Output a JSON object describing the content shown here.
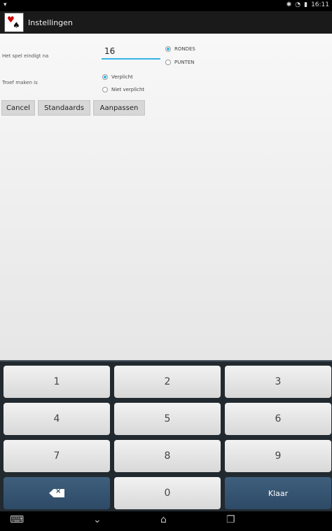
{
  "status_bar": {
    "time": "16:11"
  },
  "app_bar": {
    "title": "Instellingen"
  },
  "form": {
    "game_end_label": "Het spel eindigt na",
    "game_end_value": "16",
    "end_options": [
      "RONDES",
      "PUNTEN"
    ],
    "end_selected": 0,
    "trump_label": "Troef maken is",
    "trump_options": [
      "Verplicht",
      "Niet verplicht"
    ],
    "trump_selected": 0
  },
  "buttons": {
    "cancel": "Cancel",
    "defaults": "Standaards",
    "apply": "Aanpassen"
  },
  "keyboard": {
    "keys": [
      "1",
      "2",
      "3",
      "4",
      "5",
      "6",
      "7",
      "8",
      "9",
      "0"
    ],
    "done_label": "Klaar"
  },
  "colors": {
    "accent": "#33b5e5",
    "keyboard_action": "#2d4a66"
  }
}
